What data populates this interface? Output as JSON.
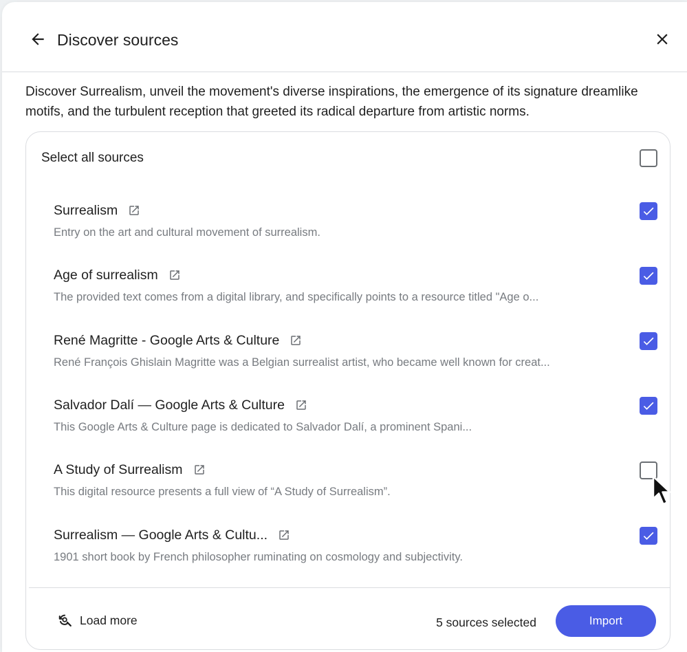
{
  "header": {
    "title": "Discover sources"
  },
  "description": "Discover Surrealism, unveil the movement's diverse inspirations, the emergence of its signature dreamlike motifs, and the turbulent reception that greeted its radical departure from artistic norms.",
  "select_all": {
    "label": "Select all sources",
    "checked": false
  },
  "sources": [
    {
      "title": "Surrealism",
      "description": "Entry on the art and cultural movement of surrealism.",
      "checked": true
    },
    {
      "title": "Age of surrealism",
      "description": "The provided text comes from a digital library, and specifically points to a resource titled \"Age o...",
      "checked": true
    },
    {
      "title": "René Magritte - Google Arts & Culture",
      "description": "René François Ghislain Magritte was a Belgian surrealist artist, who became well known for creat...",
      "checked": true
    },
    {
      "title": "Salvador Dalí — Google Arts & Culture",
      "description": "This Google Arts & Culture page is dedicated to Salvador Dalí, a prominent Spani...",
      "checked": true
    },
    {
      "title": "A Study of Surrealism",
      "description": "This digital resource presents a full view of “A Study of Surrealism”.",
      "checked": false
    },
    {
      "title": "Surrealism — Google Arts & Cultu...",
      "description": "1901 short book by French philosopher ruminating on cosmology and subjectivity.",
      "checked": true
    }
  ],
  "footer": {
    "load_more_label": "Load more",
    "selected_count": "5 sources selected",
    "import_label": "Import"
  },
  "colors": {
    "accent": "#4a5ce5",
    "secondary_text": "#777b80",
    "divider": "#dadce0"
  },
  "icons": {
    "back": "arrow-left-icon",
    "close": "close-icon",
    "external": "open-in-new-icon",
    "load_more": "search-refresh-icon",
    "check": "checkmark-icon"
  }
}
